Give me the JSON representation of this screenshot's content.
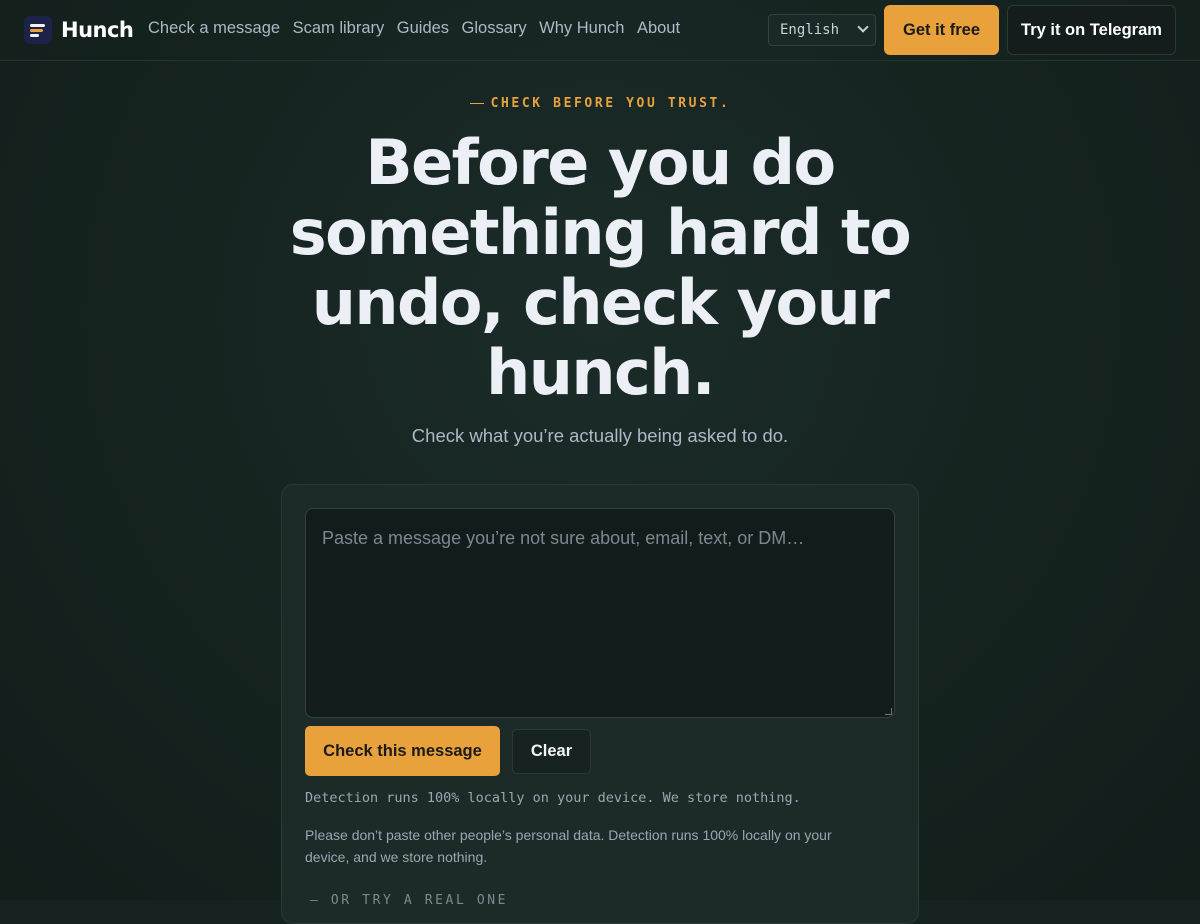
{
  "brand": {
    "name": "Hunch",
    "logo_icon": "hunch-logo-icon"
  },
  "nav": {
    "links": [
      "Check a message",
      "Scam library",
      "Guides",
      "Glossary",
      "Why Hunch",
      "About"
    ],
    "language": {
      "selected": "English"
    },
    "cta_primary": "Get it free",
    "cta_secondary": "Try it on Telegram"
  },
  "hero": {
    "eyebrow": "CHECK BEFORE YOU TRUST.",
    "headline": "Before you do something hard to undo, check your hunch.",
    "subhead": "Check what you’re actually being asked to do."
  },
  "checker": {
    "placeholder": "Paste a message you’re not sure about, email, text, or DM…",
    "check_label": "Check this message",
    "clear_label": "Clear",
    "privacy_mono": "Detection runs 100% locally on your device. We store nothing.",
    "privacy_note": "Please don’t paste other people’s personal data. Detection runs 100% locally on your device, and we store nothing.",
    "try_label": "OR TRY A REAL ONE"
  },
  "colors": {
    "accent": "#e9a23b",
    "background": "#15221f",
    "card": "#1c2b27"
  }
}
